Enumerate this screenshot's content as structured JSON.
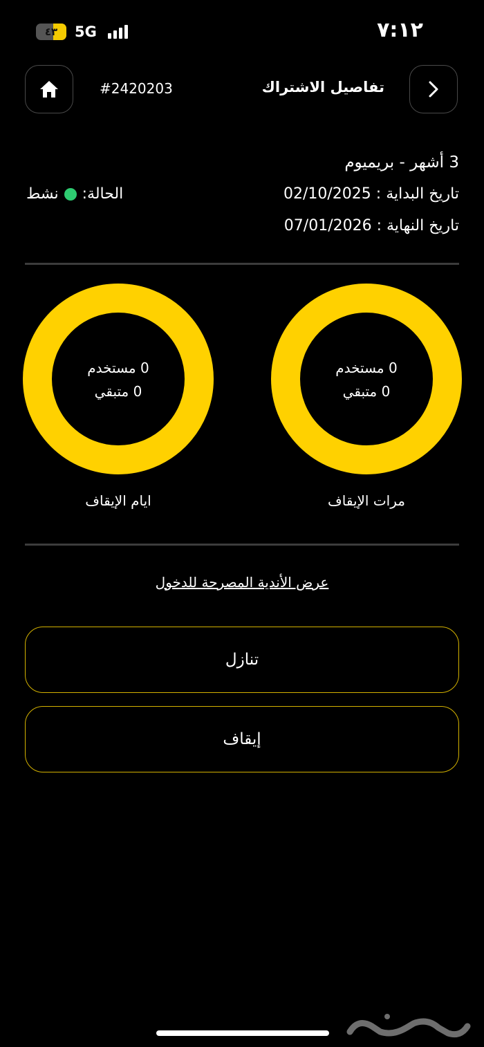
{
  "status_bar": {
    "time": "٧:١٢",
    "battery": "٤٣",
    "battery_level": 0.43,
    "network": "5G"
  },
  "header": {
    "subscription_id": "#2420203",
    "title": "تفاصيل الاشتراك"
  },
  "details": {
    "plan": "3 أشهر - بريميوم",
    "start": "تاريخ البداية : 02/10/2025",
    "end": "تاريخ النهاية : 07/01/2026",
    "status_label": "الحالة:",
    "status_value": "نشط"
  },
  "rings": [
    {
      "used": "0 مستخدم",
      "remaining": "0 متبقي",
      "label": "مرات الإيقاف"
    },
    {
      "used": "0 مستخدم",
      "remaining": "0 متبقي",
      "label": "ايام الإيقاف"
    }
  ],
  "clubs_link": "عرض الأندية المصرحة للدخول",
  "actions": {
    "waive": "تنازل",
    "freeze": "إيقاف"
  },
  "colors": {
    "accent": "#ffd100",
    "status": "#2ecc71",
    "background": "#000000",
    "border": "#4a4a4a"
  },
  "watermark": "حراج"
}
